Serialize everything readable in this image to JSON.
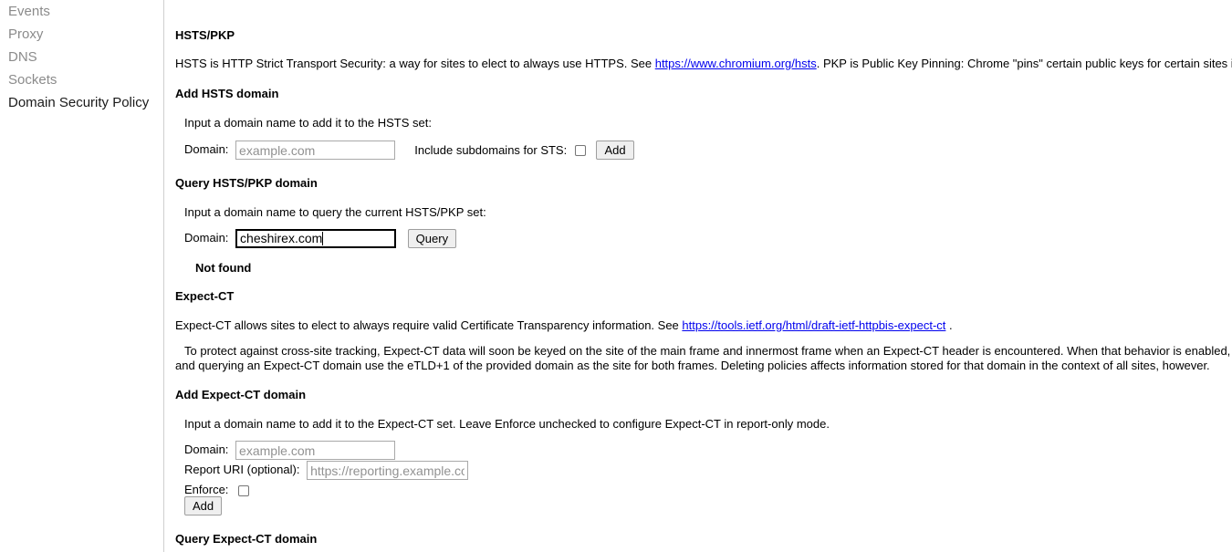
{
  "sidebar": {
    "items": [
      {
        "label": "Events",
        "active": false
      },
      {
        "label": "Proxy",
        "active": false
      },
      {
        "label": "DNS",
        "active": false
      },
      {
        "label": "Sockets",
        "active": false
      },
      {
        "label": "Domain Security Policy",
        "active": true
      }
    ]
  },
  "hsts": {
    "section_title": "HSTS/PKP",
    "description_part1": "HSTS is HTTP Strict Transport Security: a way for sites to elect to always use HTTPS. See ",
    "description_link": "https://www.chromium.org/hsts",
    "description_part2": ". PKP is Public Key Pinning: Chrome \"pins\" certain public keys for certain sites in official builds.",
    "add": {
      "heading": "Add HSTS domain",
      "instruction": "Input a domain name to add it to the HSTS set:",
      "domain_label": "Domain:",
      "domain_placeholder": "example.com",
      "domain_value": "",
      "subdomains_label": "Include subdomains for STS:",
      "subdomains_checked": false,
      "add_button": "Add"
    },
    "query": {
      "heading": "Query HSTS/PKP domain",
      "instruction": "Input a domain name to query the current HSTS/PKP set:",
      "domain_label": "Domain:",
      "domain_value": "cheshirex.com",
      "query_button": "Query",
      "result": "Not found"
    }
  },
  "expect_ct": {
    "section_title": "Expect-CT",
    "description_part1": "Expect-CT allows sites to elect to always require valid Certificate Transparency information. See ",
    "description_link": "https://tools.ietf.org/html/draft-ietf-httpbis-expect-ct",
    "description_part2": " .",
    "notice_line1": "To protect against cross-site tracking, Expect-CT data will soon be keyed on the site of the main frame and innermost frame when an Expect-CT header is encountered. When that behavior is enabled, both adding",
    "notice_line2": "and querying an Expect-CT domain use the eTLD+1 of the provided domain as the site for both frames. Deleting policies affects information stored for that domain in the context of all sites, however.",
    "add": {
      "heading": "Add Expect-CT domain",
      "instruction": "Input a domain name to add it to the Expect-CT set. Leave Enforce unchecked to configure Expect-CT in report-only mode.",
      "domain_label": "Domain:",
      "domain_placeholder": "example.com",
      "domain_value": "",
      "report_uri_label": "Report URI (optional):",
      "report_uri_placeholder": "https://reporting.example.com",
      "report_uri_value": "",
      "enforce_label": "Enforce:",
      "enforce_checked": false,
      "add_button": "Add"
    },
    "query": {
      "heading": "Query Expect-CT domain"
    }
  },
  "colors": {
    "link": "#0000ee",
    "sidebar_inactive": "#8b8b8b",
    "sidebar_active": "#1a1a1a",
    "input_border": "#a9a9a9",
    "button_bg": "#efefef"
  }
}
